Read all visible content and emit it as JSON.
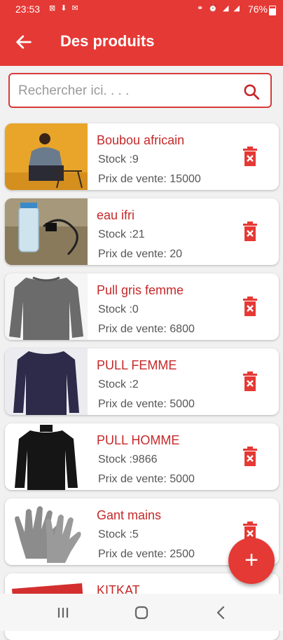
{
  "status_bar": {
    "time": "23:53",
    "left_icons": "⊠ ⬇ ✉",
    "right_icons": "⚭ ⏰ ◢ ◢",
    "battery": "76%"
  },
  "app_bar": {
    "title": "Des produits"
  },
  "search": {
    "placeholder": "Rechercher ici. . . ."
  },
  "products": [
    {
      "name": "Boubou africain",
      "stock": "Stock :9",
      "price": "Prix de vente: 15000"
    },
    {
      "name": "eau ifri",
      "stock": "Stock :21",
      "price": "Prix de vente: 20"
    },
    {
      "name": "Pull gris femme",
      "stock": "Stock :0",
      "price": "Prix de vente: 6800"
    },
    {
      "name": "PULL FEMME",
      "stock": "Stock :2",
      "price": "Prix de vente: 5000"
    },
    {
      "name": "PULL HOMME",
      "stock": "Stock :9866",
      "price": "Prix de vente: 5000"
    },
    {
      "name": "Gant mains",
      "stock": "Stock :5",
      "price": "Prix de vente: 2500"
    },
    {
      "name": "KITKAT",
      "stock": "",
      "price": ""
    }
  ],
  "fab": {
    "label": "+"
  },
  "colors": {
    "primary": "#e53935",
    "accent_text": "#c62828",
    "background": "#f1f1f1"
  }
}
